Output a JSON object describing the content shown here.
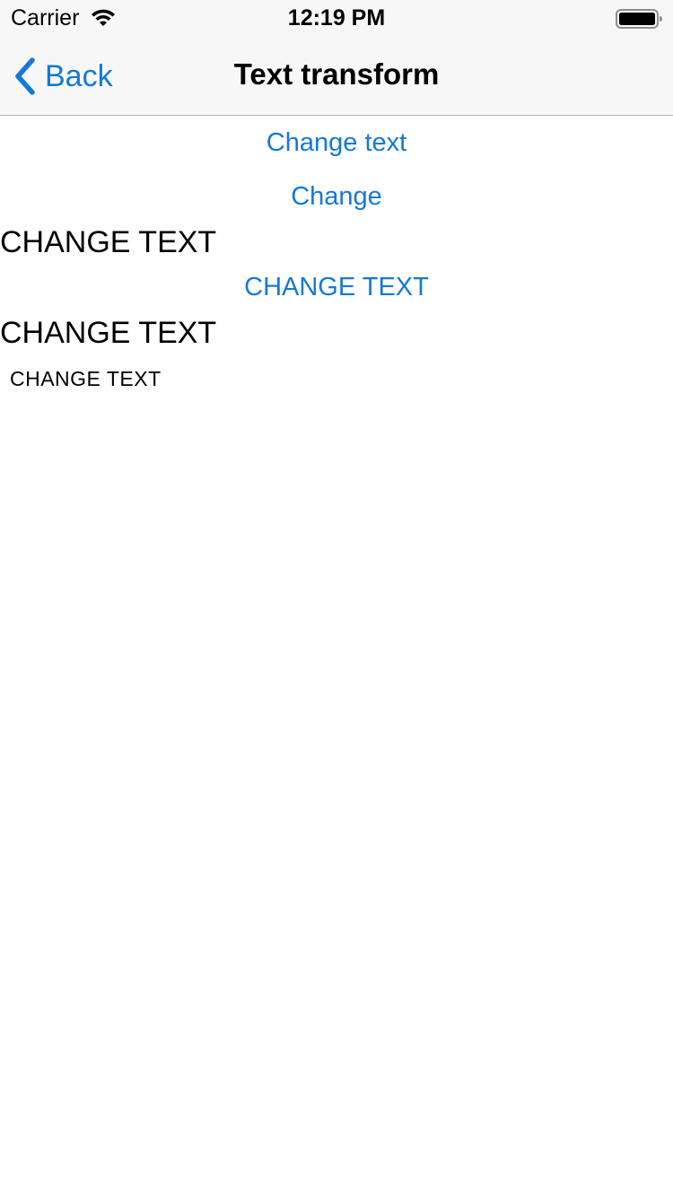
{
  "status_bar": {
    "carrier": "Carrier",
    "time": "12:19 PM",
    "wifi_icon": "wifi-icon",
    "battery_icon": "battery-icon"
  },
  "nav": {
    "back_label": "Back",
    "back_icon": "chevron-left-icon",
    "title": "Text transform"
  },
  "content": {
    "button_1": "Change text",
    "button_2": "Change",
    "label_1": "CHANGE TEXT",
    "button_3": "CHANGE TEXT",
    "label_2": "CHANGE TEXT",
    "label_3": "CHANGE TEXT"
  },
  "colors": {
    "accent": "#1479d8",
    "bar_background": "#f7f7f7",
    "text": "#000000"
  }
}
